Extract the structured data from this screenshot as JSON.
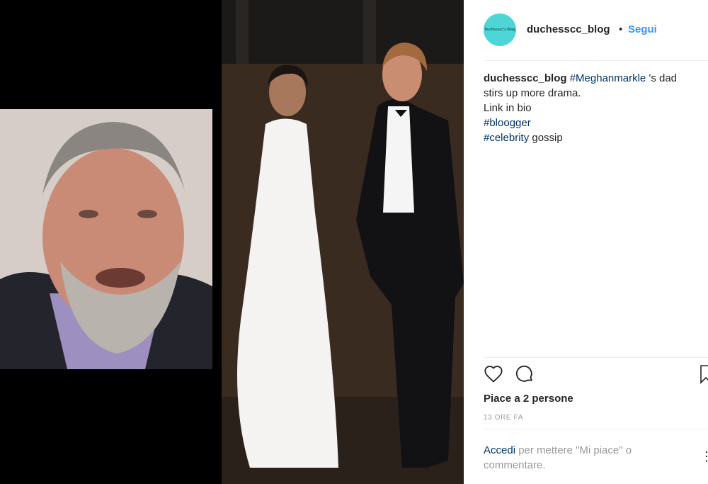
{
  "post": {
    "username": "duchesscc_blog",
    "separator": "•",
    "follow_label": "Segui",
    "avatar_text": "Duchesscc's Blog",
    "caption": {
      "author": "duchesscc_blog",
      "tag1": "#Meghanmarkle",
      "line1_rest": " 's dad",
      "line2": "stirs up more drama.",
      "line3": "Link in bio",
      "tag2": "#bloogger",
      "tag3": "#celebrity",
      "line5_rest": " gossip"
    },
    "likes": "Piace a 2 persone",
    "timestamp": "13 ORE FA",
    "login_link": "Accedi",
    "login_rest": " per mettere \"Mi piace\" o commentare."
  },
  "colors": {
    "link": "#003569",
    "follow": "#3897f0",
    "avatar_bg": "#4ed6d6"
  }
}
